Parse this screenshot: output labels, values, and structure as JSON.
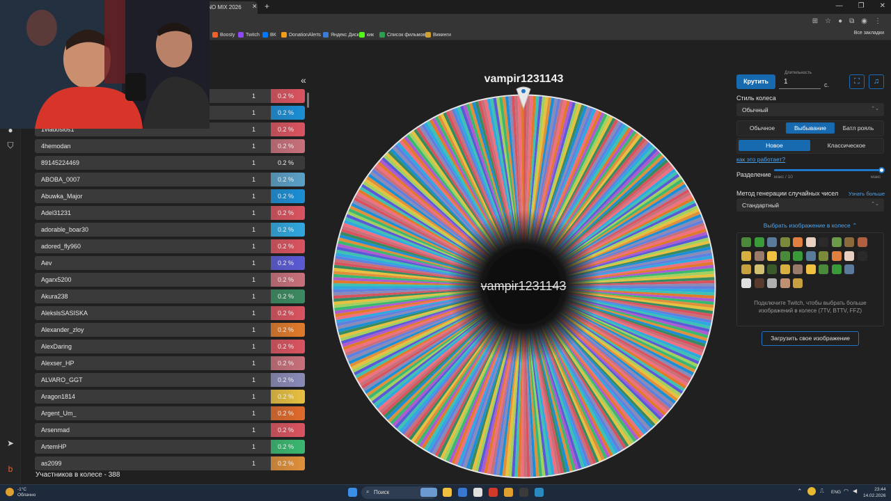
{
  "browser": {
    "active_tab_title": "INO MIX 2026",
    "bookmarks": [
      {
        "label": "Boosty",
        "color": "#f15f2c"
      },
      {
        "label": "Twitch",
        "color": "#9146ff"
      },
      {
        "label": "ВК",
        "color": "#0077ff"
      },
      {
        "label": "DonationAlerts",
        "color": "#f59c1a"
      },
      {
        "label": "Яндекс Диск",
        "color": "#3a7bd5"
      },
      {
        "label": "кик",
        "color": "#53fc18"
      },
      {
        "label": "Список фильмов",
        "color": "#2e9e4f"
      },
      {
        "label": "Викинги",
        "color": "#d0a030"
      }
    ],
    "all_bookmarks": "Все закладки"
  },
  "list": {
    "participants": [
      {
        "name": "",
        "count": "1",
        "pct": "0.2 %",
        "color": "#d9535f"
      },
      {
        "name": "",
        "count": "1",
        "pct": "0.2 %",
        "color": "#1b8ed6"
      },
      {
        "name": "1vladosios1",
        "count": "1",
        "pct": "0.2 %",
        "color": "#d9535f"
      },
      {
        "name": "4hemodan",
        "count": "1",
        "pct": "0.2 %",
        "color": "#c8707a"
      },
      {
        "name": "89145224469",
        "count": "1",
        "pct": "0.2 %",
        "color": "#3a3a3a"
      },
      {
        "name": "ABOBA_0007",
        "count": "1",
        "pct": "0.2 %",
        "color": "#5aa0c8"
      },
      {
        "name": "Abuwka_Major",
        "count": "1",
        "pct": "0.2 %",
        "color": "#1b8ed6"
      },
      {
        "name": "Adel31231",
        "count": "1",
        "pct": "0.2 %",
        "color": "#d9535f"
      },
      {
        "name": "adorable_boar30",
        "count": "1",
        "pct": "0.2 %",
        "color": "#2fa8e0"
      },
      {
        "name": "adored_fly960",
        "count": "1",
        "pct": "0.2 %",
        "color": "#d9535f"
      },
      {
        "name": "Aev",
        "count": "1",
        "pct": "0.2 %",
        "color": "#5a5ad6"
      },
      {
        "name": "Agarx5200",
        "count": "1",
        "pct": "0.2 %",
        "color": "#c8707a"
      },
      {
        "name": "Akura238",
        "count": "1",
        "pct": "0.2 %",
        "color": "#3a8a60"
      },
      {
        "name": "AlekslsSASISKA",
        "count": "1",
        "pct": "0.2 %",
        "color": "#d9535f"
      },
      {
        "name": "Alexander_zloy",
        "count": "1",
        "pct": "0.2 %",
        "color": "#e07a2a"
      },
      {
        "name": "AlexDaring",
        "count": "1",
        "pct": "0.2 %",
        "color": "#d9535f"
      },
      {
        "name": "Alexser_HP",
        "count": "1",
        "pct": "0.2 %",
        "color": "#c8707a"
      },
      {
        "name": "ALVARO_GGT",
        "count": "1",
        "pct": "0.2 %",
        "color": "#8a8ab8"
      },
      {
        "name": "Aragon1814",
        "count": "1",
        "pct": "0.2 %",
        "color": "#e8c040"
      },
      {
        "name": "Argent_Um_",
        "count": "1",
        "pct": "0.2 %",
        "color": "#e06a2a"
      },
      {
        "name": "Arsenmad",
        "count": "1",
        "pct": "0.2 %",
        "color": "#d9535f"
      },
      {
        "name": "ArtemHP",
        "count": "1",
        "pct": "0.2 %",
        "color": "#3ab870"
      },
      {
        "name": "as2099",
        "count": "1",
        "pct": "0.2 %",
        "color": "#e0903a"
      }
    ],
    "total_label": "Участников в колесе - 388"
  },
  "wheel": {
    "winner": "vampir1231143",
    "center_label": "vampir1231143",
    "segments": 388
  },
  "panel": {
    "spin_label": "Крутить",
    "duration_label": "Длительность",
    "duration_value": "1",
    "duration_unit": "с.",
    "wheel_style_label": "Стиль колеса",
    "wheel_style_value": "Обычный",
    "modes": [
      "Обычное",
      "Выбывание",
      "Батл рояль"
    ],
    "active_mode": "Выбывание",
    "variants": [
      "Новое",
      "Классическое"
    ],
    "active_variant": "Новое",
    "how_link": "как это работает?",
    "split_label": "Разделение",
    "split_min": "макс / 10",
    "split_max": "макс",
    "split_level": 1.0,
    "rng_label": "Метод генерации случайных чисел",
    "rng_learn_more": "Узнать больше",
    "rng_value": "Стандартный",
    "choose_image_label": "Выбрать изображение в колесе",
    "twitch_hint": "Подключите Twitch, чтобы выбрать больше изображений в колесе (7TV, BTTV, FFZ)",
    "upload_label": "Загрузить свое изображение"
  },
  "taskbar": {
    "weather_temp": "-1°C",
    "weather_desc": "Облачно",
    "search_placeholder": "Поиск",
    "lang": "ENG",
    "time": "23:44",
    "date": "14.02.2026"
  }
}
